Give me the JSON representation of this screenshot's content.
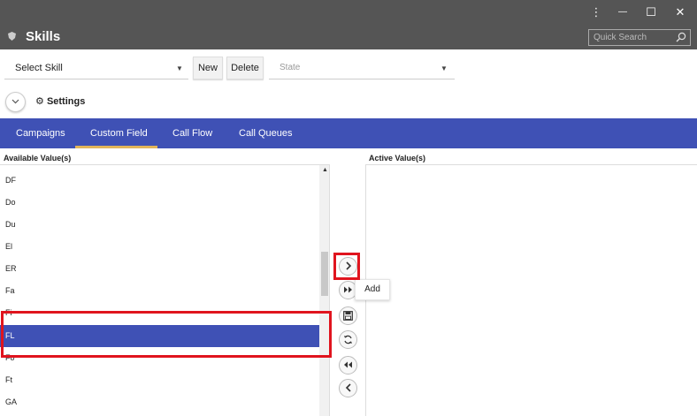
{
  "window": {
    "title": "Skills",
    "controls": {
      "menu": "⋮",
      "minimize": "—",
      "maximize": "☐",
      "close": "✕"
    },
    "quick_search_placeholder": "Quick Search"
  },
  "toolbar": {
    "skill_select": "Select Skill",
    "new_label": "New",
    "delete_label": "Delete",
    "state_placeholder": "State"
  },
  "settings_label": "Settings",
  "tabs": [
    {
      "label": "Campaigns"
    },
    {
      "label": "Custom Field",
      "active": true
    },
    {
      "label": "Call Flow"
    },
    {
      "label": "Call Queues"
    }
  ],
  "available": {
    "header": "Available Value(s)",
    "items": [
      {
        "label": "DF"
      },
      {
        "label": "Do"
      },
      {
        "label": "Du"
      },
      {
        "label": "El"
      },
      {
        "label": "ER"
      },
      {
        "label": "Fa"
      },
      {
        "label": "Fi"
      },
      {
        "label": "FL",
        "selected": true
      },
      {
        "label": "Fo"
      },
      {
        "label": "Ft"
      },
      {
        "label": "GA"
      }
    ]
  },
  "active": {
    "header": "Active Value(s)"
  },
  "transfer_buttons": {
    "add": "chevron-right-icon",
    "add_all": "double-chevron-right-icon",
    "save": "save-icon",
    "refresh": "refresh-icon",
    "remove_all": "double-chevron-left-icon",
    "remove": "chevron-left-icon"
  },
  "tooltip": "Add",
  "colors": {
    "accent": "#3f51b5",
    "titlebar": "#555555",
    "tab_underline": "#e2b55a",
    "highlight": "#e0141e"
  }
}
